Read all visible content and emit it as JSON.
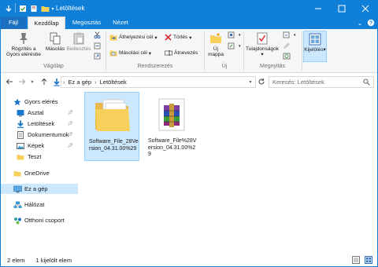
{
  "window": {
    "title": "Letöltések",
    "colors": {
      "titlebar": "#0f7fd8",
      "selection": "#cce8ff"
    }
  },
  "quick_access_toolbar": {
    "icons": [
      "save-icon",
      "properties-icon",
      "new-folder-icon",
      "customize-arrow-icon"
    ]
  },
  "ribbon_tabs": [
    "Fájl",
    "Kezdőlap",
    "Megosztás",
    "Nézet"
  ],
  "ribbon": {
    "clipboard": {
      "pin_label": "Rögzítés a Gyors elérésbe",
      "copy_label": "Másolás",
      "paste_label": "Beillesztés",
      "group_label": "Vágólap"
    },
    "organize": {
      "move_to": "Áthelyezési cél",
      "copy_to": "Másolási cél",
      "delete": "Törlés",
      "rename": "Átnevezés",
      "group_label": "Rendszerezés"
    },
    "new": {
      "new_folder": "Új mappa",
      "group_label": "Új"
    },
    "open": {
      "properties": "Tulajdonságok",
      "group_label": "Megnyitás"
    },
    "select": {
      "select_label": "Kijelölés"
    }
  },
  "address_bar": {
    "segments": [
      "Ez a gép",
      "Letöltések"
    ],
    "search_placeholder": "Keresés: Letöltések"
  },
  "nav_pane": {
    "items": [
      {
        "label": "Gyors elérés",
        "icon": "star-icon"
      },
      {
        "label": "Asztal",
        "icon": "desktop-icon",
        "pinned": true
      },
      {
        "label": "Letöltések",
        "icon": "download-icon",
        "pinned": true
      },
      {
        "label": "Dokumentumok",
        "icon": "documents-icon",
        "pinned": true
      },
      {
        "label": "Képek",
        "icon": "pictures-icon",
        "pinned": true
      },
      {
        "label": "Teszt",
        "icon": "folder-icon"
      },
      {
        "label": "OneDrive",
        "icon": "folder-icon"
      },
      {
        "label": "Ez a gép",
        "icon": "computer-icon",
        "selected": true
      },
      {
        "label": "Hálózat",
        "icon": "network-icon"
      },
      {
        "label": "Otthoni csoport",
        "icon": "homegroup-icon"
      }
    ]
  },
  "files": [
    {
      "name": "Software_File_28Version_04.31.00%29",
      "icon": "folder-icon",
      "selected": true
    },
    {
      "name": "Software_File%28Version_04.31.00%29",
      "icon": "winrar-archive-icon",
      "selected": false
    }
  ],
  "status_bar": {
    "item_count": "2 elem",
    "selection": "1 kijelölt elem"
  }
}
